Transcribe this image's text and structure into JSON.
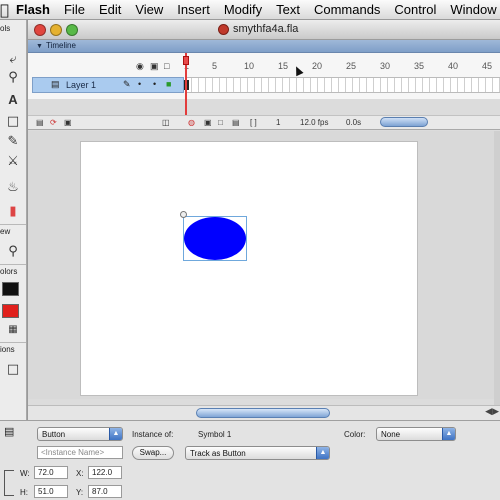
{
  "menubar": {
    "app_name": "Flash",
    "items": [
      "File",
      "Edit",
      "View",
      "Insert",
      "Modify",
      "Text",
      "Commands",
      "Control",
      "Window"
    ]
  },
  "tools": {
    "labels": {
      "tools": "ols",
      "view": "ew",
      "colors": "olors",
      "options": "ions"
    },
    "stroke_color": "#111111",
    "fill_color": "#e0201c"
  },
  "document": {
    "title": "smythfa4a.fla",
    "timeline_label": "Timeline",
    "layer_name": "Layer 1",
    "frame_numbers": [
      "1",
      "5",
      "10",
      "15",
      "20",
      "25",
      "30",
      "35",
      "40",
      "45"
    ],
    "status": {
      "frame": "1",
      "fps": "12.0 fps",
      "time": "0.0s"
    }
  },
  "stage": {
    "shape_color": "#0000ff",
    "background": "#ffffff"
  },
  "properties": {
    "symbol_type": "Button",
    "instance_name_placeholder": "<Instance Name>",
    "instance_of_label": "Instance of:",
    "instance_of_value": "Symbol 1",
    "swap_label": "Swap...",
    "tracking": "Track as Button",
    "color_label": "Color:",
    "color_value": "None",
    "w_label": "W:",
    "w_value": "72.0",
    "x_label": "X:",
    "x_value": "122.0",
    "h_label": "H:",
    "h_value": "51.0",
    "y_label": "Y:",
    "y_value": "87.0"
  }
}
